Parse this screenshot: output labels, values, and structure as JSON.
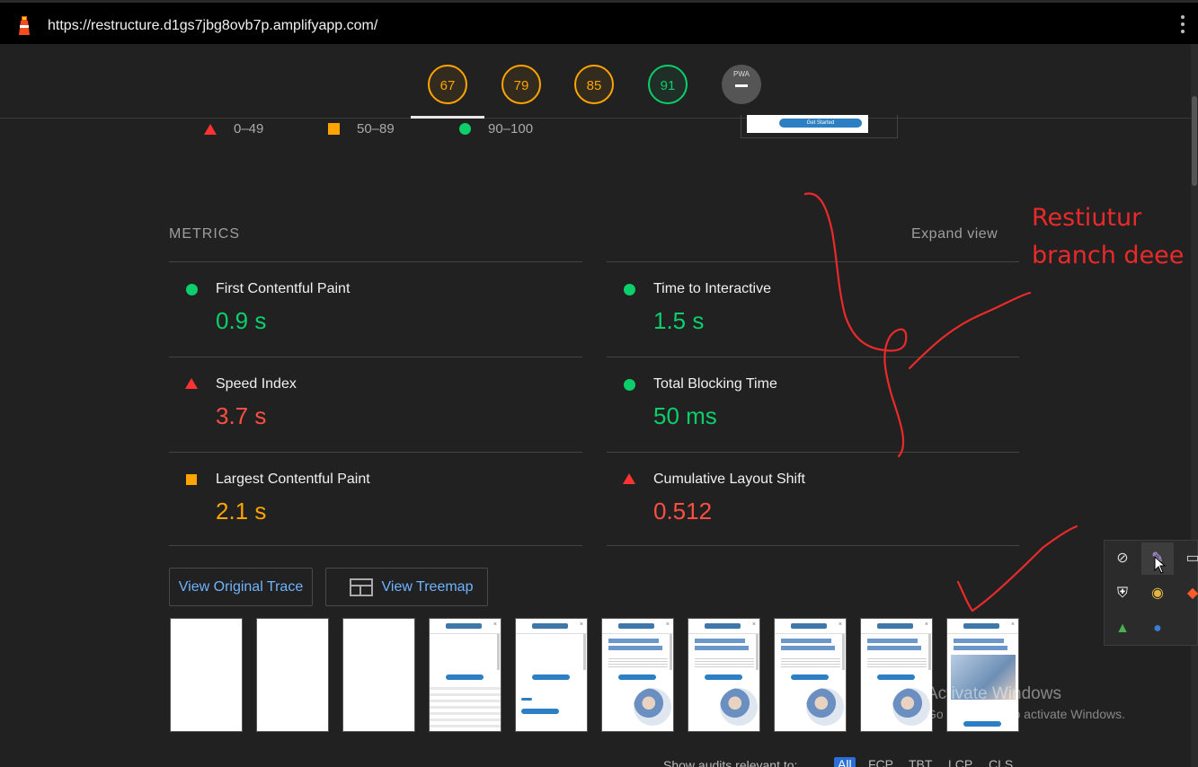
{
  "browser": {
    "url": "https://restructure.d1gs7jbg8ovb7p.amplifyapp.com/",
    "logo_icon": "lighthouse-icon",
    "menu_icon": "kebab-menu-icon"
  },
  "scores": [
    {
      "value": "67",
      "status": "average"
    },
    {
      "value": "79",
      "status": "average"
    },
    {
      "value": "85",
      "status": "average"
    },
    {
      "value": "91",
      "status": "pass"
    },
    {
      "value": "PWA",
      "status": "na"
    }
  ],
  "legend": [
    {
      "range": "0–49",
      "icon": "fail-triangle-icon"
    },
    {
      "range": "50–89",
      "icon": "average-square-icon"
    },
    {
      "range": "90–100",
      "icon": "pass-circle-icon"
    }
  ],
  "screenshot_preview": {
    "button": "Get Started"
  },
  "metrics": {
    "title": "METRICS",
    "expand_label": "Expand view",
    "items": [
      {
        "name": "First Contentful Paint",
        "value": "0.9 s",
        "status": "pass"
      },
      {
        "name": "Time to Interactive",
        "value": "1.5 s",
        "status": "pass"
      },
      {
        "name": "Speed Index",
        "value": "3.7 s",
        "status": "fail"
      },
      {
        "name": "Total Blocking Time",
        "value": "50 ms",
        "status": "pass"
      },
      {
        "name": "Largest Contentful Paint",
        "value": "2.1 s",
        "status": "average"
      },
      {
        "name": "Cumulative Layout Shift",
        "value": "0.512",
        "status": "fail"
      }
    ]
  },
  "actions": {
    "view_trace": "View Original Trace",
    "view_treemap": "View Treemap"
  },
  "annotation": {
    "line1": "Restiutur",
    "line2": "branch deee"
  },
  "watermark": {
    "title": "Activate Windows",
    "subtitle": "Go to Settings to activate Windows."
  },
  "filter": {
    "label": "Show audits relevant to:",
    "chips": [
      "All",
      "FCP",
      "TBT",
      "LCP",
      "CLS"
    ]
  },
  "colors": {
    "pass": "#0cce6b",
    "average": "#ffa400",
    "fail": "#ff4e42",
    "link": "#6fb4ff"
  }
}
